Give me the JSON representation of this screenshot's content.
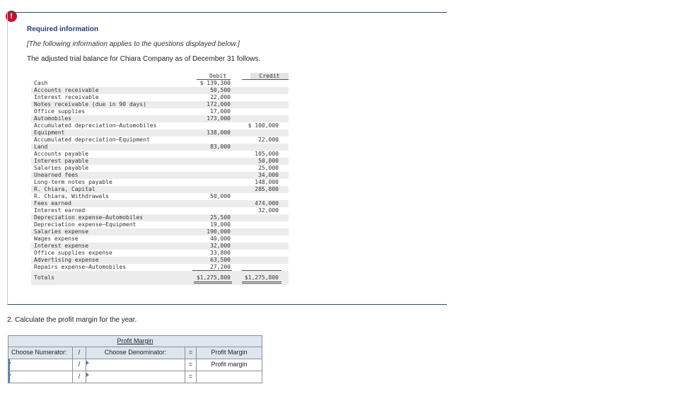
{
  "alert_icon": "!",
  "header": {
    "title": "Required information",
    "note": "[The following information applies to the questions displayed below.]",
    "intro": "The adjusted trial balance for Chiara Company as of December 31 follows."
  },
  "trial_balance": {
    "debit_label": "Debit",
    "credit_label": "Credit",
    "rows": [
      {
        "name": "Cash",
        "debit": "$ 139,300",
        "credit": ""
      },
      {
        "name": "Accounts receivable",
        "debit": "50,500",
        "credit": ""
      },
      {
        "name": "Interest receivable",
        "debit": "22,000",
        "credit": ""
      },
      {
        "name": "Notes receivable (due in 90 days)",
        "debit": "172,000",
        "credit": ""
      },
      {
        "name": "Office supplies",
        "debit": "17,000",
        "credit": ""
      },
      {
        "name": "Automobiles",
        "debit": "173,000",
        "credit": ""
      },
      {
        "name": "Accumulated depreciation—Automobiles",
        "debit": "",
        "credit": "$ 100,000"
      },
      {
        "name": "Equipment",
        "debit": "138,000",
        "credit": ""
      },
      {
        "name": "Accumulated depreciation—Equipment",
        "debit": "",
        "credit": "22,000"
      },
      {
        "name": "Land",
        "debit": "83,000",
        "credit": ""
      },
      {
        "name": "Accounts payable",
        "debit": "",
        "credit": "105,000"
      },
      {
        "name": "Interest payable",
        "debit": "",
        "credit": "50,000"
      },
      {
        "name": "Salaries payable",
        "debit": "",
        "credit": "25,000"
      },
      {
        "name": "Unearned fees",
        "debit": "",
        "credit": "34,000"
      },
      {
        "name": "Long-term notes payable",
        "debit": "",
        "credit": "148,000"
      },
      {
        "name": "R. Chiara, Capital",
        "debit": "",
        "credit": "285,800"
      },
      {
        "name": "R. Chiara, Withdrawals",
        "debit": "50,000",
        "credit": ""
      },
      {
        "name": "Fees earned",
        "debit": "",
        "credit": "474,000"
      },
      {
        "name": "Interest earned",
        "debit": "",
        "credit": "32,000"
      },
      {
        "name": "Depreciation expense—Automobiles",
        "debit": "25,500",
        "credit": ""
      },
      {
        "name": "Depreciation expense—Equipment",
        "debit": "19,000",
        "credit": ""
      },
      {
        "name": "Salaries expense",
        "debit": "190,000",
        "credit": ""
      },
      {
        "name": "Wages expense",
        "debit": "40,000",
        "credit": ""
      },
      {
        "name": "Interest expense",
        "debit": "32,000",
        "credit": ""
      },
      {
        "name": "Office supplies expense",
        "debit": "33,800",
        "credit": ""
      },
      {
        "name": "Advertising expense",
        "debit": "63,500",
        "credit": ""
      },
      {
        "name": "Repairs expense—Automobiles",
        "debit": "27,200",
        "credit": ""
      }
    ],
    "totals": {
      "name": "Totals",
      "debit": "$1,275,800",
      "credit": "$1,275,800"
    }
  },
  "question": "2. Calculate the profit margin for the year.",
  "profit_margin": {
    "title": "Profit Margin",
    "numerator_label": "Choose Numerator:",
    "slash": "/",
    "denominator_label": "Choose Denominator:",
    "equals": "=",
    "result_label": "Profit Margin",
    "rows": [
      {
        "numerator": "",
        "denominator": "",
        "result": "Profit margin"
      },
      {
        "numerator": "",
        "denominator": "",
        "result": ""
      }
    ]
  }
}
